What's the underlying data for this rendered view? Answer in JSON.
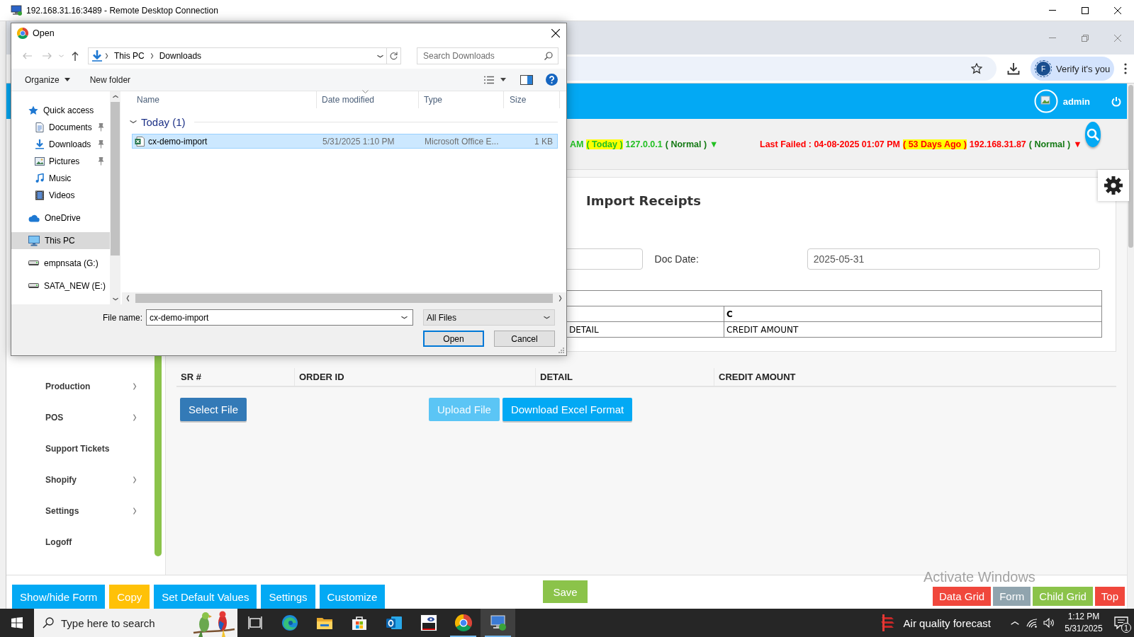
{
  "remote_window": {
    "title": "192.168.31.16:3489 - Remote Desktop Connection"
  },
  "browser": {
    "profile_initial": "F",
    "profile_label": "Verify it's you"
  },
  "app": {
    "user": "admin",
    "status": [
      {
        "segments": [
          {
            "text": "AM",
            "color": "#22c022",
            "highlight": false
          },
          {
            "text": "( Today )",
            "highlight": true
          },
          {
            "text": "127.0.0.1",
            "color": "#22c022",
            "highlight": false
          },
          {
            "text": "( Normal )",
            "color": "#157a15",
            "highlight": false
          },
          {
            "text": "▼",
            "color": "#22c022",
            "highlight": false
          }
        ]
      },
      {
        "segments": [
          {
            "text": "Last Failed : 04-08-2025 01:07 PM",
            "color": "#ff0000",
            "highlight": false
          },
          {
            "text": "( 53 Days Ago )",
            "highlight": true
          },
          {
            "text": "192.168.31.87",
            "color": "#ff0000",
            "highlight": false
          },
          {
            "text": "( Normal )",
            "color": "#157a15",
            "highlight": false
          },
          {
            "text": "▼",
            "color": "#ff0000",
            "highlight": false
          }
        ]
      }
    ],
    "page_title": "Import Receipts",
    "form": {
      "doc_date_label": "Doc Date:",
      "doc_date": "2025-05-31"
    },
    "format_table": {
      "column_letter": "C",
      "headers": [
        "DETAIL",
        "CREDIT AMOUNT"
      ]
    },
    "grid": {
      "columns": [
        "SR #",
        "ORDER ID",
        "DETAIL",
        "CREDIT AMOUNT"
      ]
    },
    "actions": [
      {
        "label": "Select File",
        "color": "#337ab7",
        "disabled": false
      },
      {
        "label": "Upload File",
        "color": "#5bc5f5",
        "disabled": true
      },
      {
        "label": "Download Excel Format",
        "color": "#03a9f4",
        "disabled": false
      }
    ],
    "sidebar": {
      "items": [
        {
          "label": "Production",
          "submenu": true
        },
        {
          "label": "POS",
          "submenu": true
        },
        {
          "label": "Support Tickets",
          "submenu": false
        },
        {
          "label": "Shopify",
          "submenu": true
        },
        {
          "label": "Settings",
          "submenu": true
        },
        {
          "label": "Logoff",
          "submenu": false
        }
      ]
    },
    "toolbar": {
      "left": [
        {
          "label": "Show/hide Form",
          "color": "#03a9f4"
        },
        {
          "label": "Copy",
          "color": "#ffc107"
        },
        {
          "label": "Set Default Values",
          "color": "#03a9f4"
        },
        {
          "label": "Settings",
          "color": "#03a9f4"
        },
        {
          "label": "Customize",
          "color": "#03a9f4"
        }
      ],
      "save": {
        "label": "Save",
        "color": "#8bc34a"
      },
      "right": [
        {
          "label": "Data Grid",
          "color": "#f0473c"
        },
        {
          "label": "Form",
          "color": "#90a4ae"
        },
        {
          "label": "Child Grid",
          "color": "#8bc34a"
        },
        {
          "label": "Top",
          "color": "#f0473c"
        }
      ]
    },
    "activation_notice": "Activate Windows"
  },
  "dialog": {
    "title": "Open",
    "path": [
      "This PC",
      "Downloads"
    ],
    "search": {
      "placeholder": "Search Downloads"
    },
    "commands": [
      {
        "label": "Organize",
        "menu": true
      },
      {
        "label": "New folder",
        "menu": false
      }
    ],
    "nav": [
      {
        "label": "Quick access",
        "kind": "star",
        "selected": false,
        "children": [
          {
            "label": "Documents",
            "kind": "documents",
            "pinned": true,
            "selected": false
          },
          {
            "label": "Downloads",
            "kind": "downloads",
            "pinned": true,
            "selected": false
          },
          {
            "label": "Pictures",
            "kind": "pictures",
            "pinned": true,
            "selected": false
          },
          {
            "label": "Music",
            "kind": "music",
            "pinned": false,
            "selected": false
          },
          {
            "label": "Videos",
            "kind": "videos",
            "pinned": false,
            "selected": false
          }
        ]
      },
      {
        "label": "OneDrive",
        "kind": "cloud",
        "selected": false
      },
      {
        "label": "This PC",
        "kind": "computer",
        "selected": true
      },
      {
        "label": "empnsata (G:)",
        "kind": "drive",
        "selected": false
      },
      {
        "label": "SATA_NEW (E:)",
        "kind": "drive",
        "selected": false
      }
    ],
    "columns": [
      "Name",
      "Date modified",
      "Type",
      "Size"
    ],
    "group": "Today (1)",
    "files": [
      {
        "name": "cx-demo-import",
        "date": "5/31/2025 1:10 PM",
        "type": "Microsoft Office E...",
        "size": "1 KB",
        "selected": true
      }
    ],
    "file_name_label": "File name:",
    "file_name": "cx-demo-import",
    "filter": "All Files",
    "buttons": [
      {
        "label": "Open",
        "default": true
      },
      {
        "label": "Cancel",
        "default": false
      }
    ]
  },
  "taskbar": {
    "search_placeholder": "Type here to search",
    "apps": [
      {
        "kind": "task-view",
        "running": false,
        "active": false
      },
      {
        "kind": "edge",
        "running": false,
        "active": false
      },
      {
        "kind": "explorer",
        "running": false,
        "active": false
      },
      {
        "kind": "store",
        "running": false,
        "active": false
      },
      {
        "kind": "outlook",
        "running": false,
        "active": false
      },
      {
        "kind": "vnc",
        "running": false,
        "active": false
      },
      {
        "kind": "chrome",
        "running": true,
        "active": false
      },
      {
        "kind": "remote-desktop",
        "running": true,
        "active": true
      }
    ],
    "weather": "Air quality forecast",
    "time": "1:12 PM",
    "date": "5/31/2025",
    "notifications": "1"
  }
}
